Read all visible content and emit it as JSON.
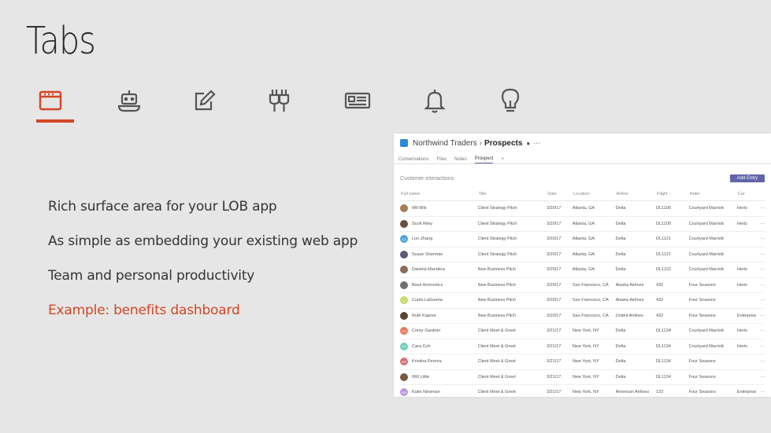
{
  "slide": {
    "title": "Tabs",
    "icons": [
      {
        "name": "tab-window-icon",
        "active": true
      },
      {
        "name": "bot-icon",
        "active": false
      },
      {
        "name": "compose-icon",
        "active": false
      },
      {
        "name": "connector-plug-icon",
        "active": false
      },
      {
        "name": "card-icon",
        "active": false
      },
      {
        "name": "notification-bell-icon",
        "active": false
      },
      {
        "name": "lightbulb-icon",
        "active": false
      }
    ],
    "bullets": [
      "Rich surface area for your LOB app",
      "As simple as embedding your existing web app",
      "Team and personal productivity",
      "Example: benefits dashboard"
    ],
    "accent_color": "#d24726"
  },
  "app": {
    "team_name": "Northwind Traders",
    "channel_name": "Prospects",
    "tabs": [
      "Conversations",
      "Files",
      "Notes",
      "Prospect",
      "+"
    ],
    "selected_tab": 3,
    "section_title": "Customer interactions",
    "add_button": "Add Entry",
    "columns": [
      "Full name",
      "Title",
      "Date",
      "Location",
      "Airline",
      "Flight",
      "Hotel",
      "Car"
    ],
    "rows": [
      {
        "name": "Wil Wik",
        "title": "Client Strategy Pitch",
        "date": "3/20/17",
        "location": "Atlanta, GA",
        "airline": "Delta",
        "flight": "DL1100",
        "hotel": "Courtyard Marriott",
        "car": "Hertz",
        "avatar_color": "#a67c52"
      },
      {
        "name": "Scott Riley",
        "title": "Client Strategy Pitch",
        "date": "3/20/17",
        "location": "Atlanta, GA",
        "airline": "Delta",
        "flight": "DL1100",
        "hotel": "Courtyard Marriott",
        "car": "Hertz",
        "avatar_color": "#6b4f3a"
      },
      {
        "name": "Lori Zhang",
        "title": "Client Strategy Pitch",
        "date": "3/20/17",
        "location": "Atlanta, GA",
        "airline": "Delta",
        "flight": "DL1121",
        "hotel": "Courtyard Marriott",
        "car": "",
        "avatar_color": "#4fa3e0",
        "initials": "LZ"
      },
      {
        "name": "Susan Sherman",
        "title": "Client Strategy Pitch",
        "date": "3/20/17",
        "location": "Atlanta, GA",
        "airline": "Delta",
        "flight": "DL1121",
        "hotel": "Courtyard Marriott",
        "car": "",
        "avatar_color": "#5a5a7a"
      },
      {
        "name": "Daniela Mandera",
        "title": "New Business Pitch",
        "date": "3/20/17",
        "location": "Atlanta, GA",
        "airline": "Delta",
        "flight": "DL1221",
        "hotel": "Courtyard Marriott",
        "car": "Hertz",
        "avatar_color": "#8a6d5a"
      },
      {
        "name": "Basil Hrenovitcz",
        "title": "New Business Pitch",
        "date": "3/20/17",
        "location": "San Francisco, CA",
        "airline": "Alaska Airlines",
        "flight": "432",
        "hotel": "Four Seasons",
        "car": "Hertz",
        "avatar_color": "#707070"
      },
      {
        "name": "Curtis LaGuerta",
        "title": "New Business Pitch",
        "date": "3/20/17",
        "location": "San Francisco, CA",
        "airline": "Alaska Airlines",
        "flight": "432",
        "hotel": "Four Seasons",
        "car": "",
        "avatar_color": "#c9d86a",
        "initials": "CL"
      },
      {
        "name": "Ruth Kapoor",
        "title": "New Business Pitch",
        "date": "3/20/17",
        "location": "San Francisco, CA",
        "airline": "United Airlines",
        "flight": "432",
        "hotel": "Four Seasons",
        "car": "Enterprise",
        "avatar_color": "#5b4636"
      },
      {
        "name": "Corey Gardner",
        "title": "Client Meet & Greet",
        "date": "3/21/17",
        "location": "New York, NY",
        "airline": "Delta",
        "flight": "DL1134",
        "hotel": "Courtyard Marriott",
        "car": "Hertz",
        "avatar_color": "#e8795a",
        "initials": "CG"
      },
      {
        "name": "Cara Coh",
        "title": "Client Meet & Greet",
        "date": "3/21/17",
        "location": "New York, NY",
        "airline": "Delta",
        "flight": "DL1134",
        "hotel": "Courtyard Marriott",
        "car": "Hertz",
        "avatar_color": "#6fcfc0",
        "initials": "CC"
      },
      {
        "name": "Kristina Pereira",
        "title": "Client Meet & Greet",
        "date": "3/21/17",
        "location": "New York, NY",
        "airline": "Delta",
        "flight": "DL1134",
        "hotel": "Four Seasons",
        "car": "",
        "avatar_color": "#d96f7a",
        "initials": "KP"
      },
      {
        "name": "Will Little",
        "title": "Client Meet & Greet",
        "date": "3/21/17",
        "location": "New York, NY",
        "airline": "Delta",
        "flight": "DL1134",
        "hotel": "Four Seasons",
        "car": "",
        "avatar_color": "#7a5a40"
      },
      {
        "name": "Katie Newman",
        "title": "Client Meet & Greet",
        "date": "3/21/17",
        "location": "New York, NY",
        "airline": "American Airlines",
        "flight": "122",
        "hotel": "Four Seasons",
        "car": "Enterprise",
        "avatar_color": "#b89ae0",
        "initials": "KN"
      }
    ]
  }
}
